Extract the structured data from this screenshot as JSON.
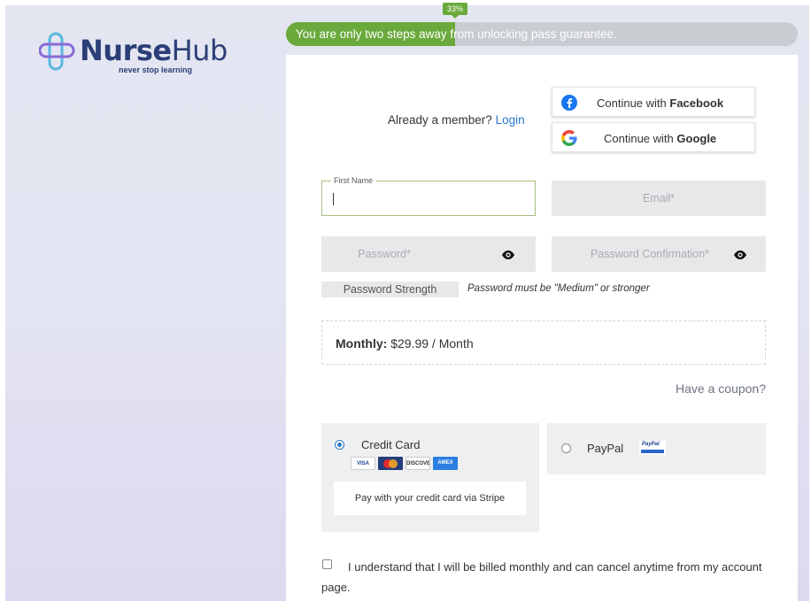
{
  "brand": {
    "name_bold": "Nurse",
    "name_regular": "Hub",
    "tagline": "never stop learning",
    "colors": {
      "primary": "#2c3e77",
      "accent": "#5ab7e0",
      "logo_purple": "#8a6ad6"
    }
  },
  "progress": {
    "percent_label": "33%",
    "fraction": 0.33,
    "message": "You are only two steps away from unlocking pass guarantee.",
    "colors": {
      "fill": "#6aaa3c",
      "track": "#c9ccd0"
    }
  },
  "login": {
    "prompt": "Already a member?",
    "link": "Login"
  },
  "social": {
    "facebook": {
      "prefix": "Continue with ",
      "brand": "Facebook",
      "icon": "facebook-icon"
    },
    "google": {
      "prefix": "Continue with ",
      "brand": "Google",
      "icon": "google-icon"
    }
  },
  "form": {
    "first_name": {
      "label": "First Name",
      "value": ""
    },
    "email": {
      "placeholder": "Email*"
    },
    "password": {
      "placeholder": "Password*",
      "icon": "eye-icon"
    },
    "password_confirmation": {
      "placeholder": "Password Confirmation*",
      "icon": "eye-icon"
    },
    "strength_label": "Password Strength",
    "strength_note": "Password must be \"Medium\" or stronger"
  },
  "plan": {
    "label": "Monthly:",
    "price": "$29.99 / Month"
  },
  "coupon": {
    "link": "Have a coupon?"
  },
  "payment": {
    "credit_card": {
      "label": "Credit Card",
      "selected": true,
      "logos": [
        "VISA",
        "MasterCard",
        "DISCOVER",
        "AMEX"
      ],
      "description": "Pay with your credit card via Stripe"
    },
    "paypal": {
      "label": "PayPal",
      "logo": "PayPal",
      "selected": false
    }
  },
  "terms": {
    "text": "I understand that I will be billed monthly and can cancel anytime from my account page.",
    "checked": false
  }
}
